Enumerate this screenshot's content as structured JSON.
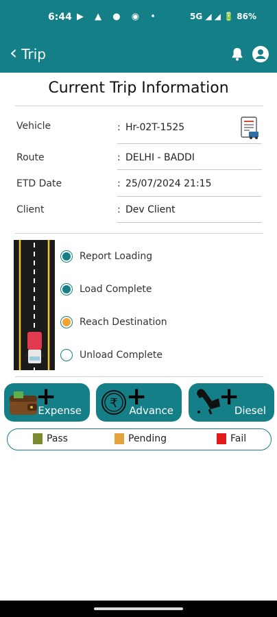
{
  "status_bar": {
    "time": "6:44",
    "right_text": "5G ◢ ◢ 🔋 86%"
  },
  "app_bar": {
    "title": "Trip",
    "icons": [
      "chevron-left-icon",
      "bell-icon",
      "account-icon"
    ]
  },
  "page_title": "Current Trip Information",
  "trip_info": [
    {
      "label": "Vehicle",
      "value": "Hr-02T-1525"
    },
    {
      "label": "Route",
      "value": "DELHI - BADDI"
    },
    {
      "label": "ETD Date",
      "value": "25/07/2024 21:15"
    },
    {
      "label": "Client",
      "value": "Dev Client"
    }
  ],
  "colon": ":",
  "steps": [
    {
      "label": "Report Loading",
      "state": "complete"
    },
    {
      "label": "Load Complete",
      "state": "complete"
    },
    {
      "label": "Reach Destination",
      "state": "pending"
    },
    {
      "label": "Unload Complete",
      "state": "empty"
    }
  ],
  "actions": [
    {
      "label": "Expense",
      "icon": "wallet-icon"
    },
    {
      "label": "Advance",
      "icon": "rupee-icon"
    },
    {
      "label": "Diesel",
      "icon": "fuel-nozzle-icon"
    }
  ],
  "legend": [
    {
      "label": "Pass",
      "color": "#7b8a2e"
    },
    {
      "label": "Pending",
      "color": "#e3a33a"
    },
    {
      "label": "Fail",
      "color": "#e0191b"
    }
  ],
  "colors": {
    "primary": "#147f86",
    "step_complete": "#147f86",
    "step_pending": "#f2a231"
  }
}
